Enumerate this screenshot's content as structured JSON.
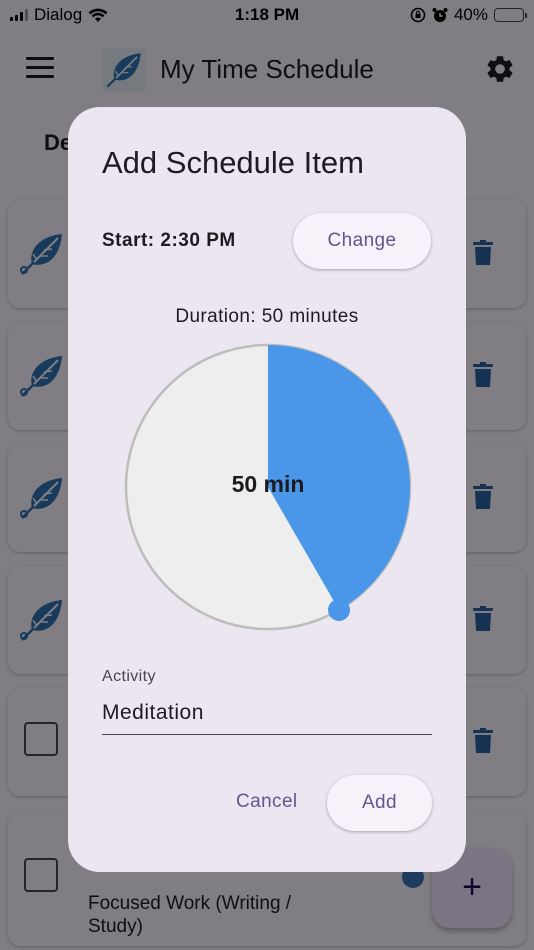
{
  "status_bar": {
    "carrier": "Dialog",
    "time": "1:18 PM",
    "battery": "40%",
    "battery_level": 0.4
  },
  "app_bar": {
    "title": "My Time Schedule"
  },
  "background": {
    "section_title": "De",
    "list_items": [
      {
        "icon": "leaf-icon",
        "text": ""
      },
      {
        "icon": "leaf-icon",
        "text": ""
      },
      {
        "icon": "leaf-icon",
        "text": ""
      },
      {
        "icon": "leaf-icon",
        "text": ""
      },
      {
        "icon": "checkbox",
        "text": ""
      },
      {
        "icon": "checkbox",
        "text": "Focused Work (Writing / Study)"
      }
    ],
    "fab_label": "+"
  },
  "dialog": {
    "title": "Add Schedule Item",
    "start_label": "Start: 2:30 PM",
    "change_button": "Change",
    "duration_label": "Duration: 50 minutes",
    "dial": {
      "value_label": "50 min",
      "minutes": 50,
      "max_minutes": 120,
      "fill_color": "#4a96e8",
      "track_color": "#eeeeee"
    },
    "activity_label": "Activity",
    "activity_value": "Meditation",
    "cancel_button": "Cancel",
    "add_button": "Add"
  },
  "colors": {
    "accent": "#65558f",
    "leaf": "#2f6fae",
    "trash": "#2b5f9e"
  }
}
